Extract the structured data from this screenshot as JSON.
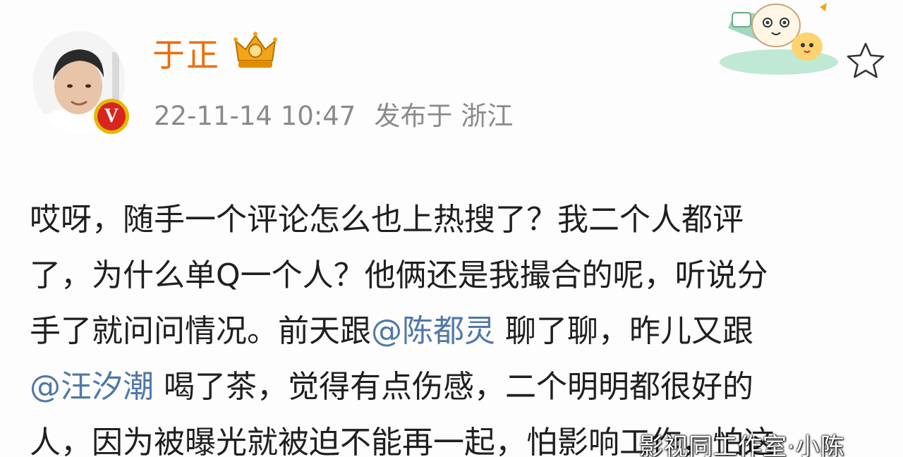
{
  "post": {
    "author": {
      "name": "于正",
      "verified_mark": "V",
      "avatar_icon": "avatar-photo",
      "member_badge_icon": "crown-vip-badge"
    },
    "timestamp": "22-11-14 10:47",
    "location_prefix": "发布于",
    "location": "浙江",
    "favorite_icon": "star-outline-icon",
    "sticker_icon": "cartoon-sticker",
    "body": {
      "line1": "哎呀，随手一个评论怎么也上热搜了？我二个人都评",
      "line2": "了，为什么单Q一个人？他俩还是我撮合的呢，听说分",
      "line3_a": "手了就问问情况。前天跟",
      "mention1": "@陈都灵",
      "line3_b": " 聊了聊，昨儿又跟",
      "mention2": "@汪汐潮",
      "line4_b": " 喝了茶，觉得有点伤感，二个明明都很好的",
      "line5": "人，因为被曝光就被迫不能再一起，怕影响工作，怕这"
    }
  },
  "watermark": {
    "text": "影视同工作室·小陈"
  },
  "colors": {
    "username": "#ef6c00",
    "meta": "#8a8a8a",
    "body": "#1f1f1f",
    "mention": "#5078a8",
    "verified_red": "#d7261e",
    "verified_gold": "#e6b800"
  }
}
